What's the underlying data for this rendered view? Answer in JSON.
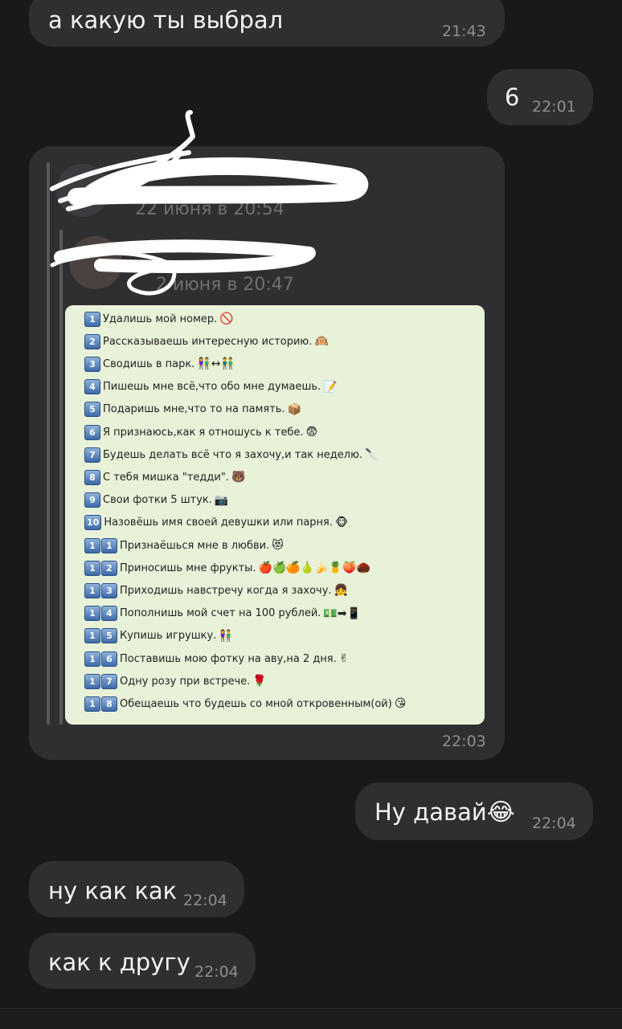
{
  "messages": {
    "m1": {
      "text": "а какую ты выбрал",
      "time": "21:43"
    },
    "m2": {
      "text": "6",
      "time": "22:01"
    },
    "m3": {
      "forward_date_outer": "22 июня в 20:54",
      "forward_date_inner": "2 июня в 20:47",
      "time": "22:03"
    },
    "m4": {
      "text": "Ну давай",
      "emoji": "😂",
      "time": "22:04"
    },
    "m5": {
      "text": "ну как как",
      "time": "22:04"
    },
    "m6": {
      "text": "как к другу",
      "time": "22:04"
    }
  },
  "photo_list": [
    {
      "num": [
        "1"
      ],
      "text": "Удалишь мой номер.",
      "emoji": "🚫"
    },
    {
      "num": [
        "2"
      ],
      "text": "Рассказываешь интересную историю.",
      "emoji": "🙉"
    },
    {
      "num": [
        "3"
      ],
      "text": "Сводишь в парк.",
      "emoji": "👫↔👬"
    },
    {
      "num": [
        "4"
      ],
      "text": "Пишешь мне всё,что обо мне думаешь.",
      "emoji": "📝"
    },
    {
      "num": [
        "5"
      ],
      "text": "Подаришь мне,что то на память.",
      "emoji": "📦"
    },
    {
      "num": [
        "6"
      ],
      "text": "Я признаюсь,как я отношусь к тебе.",
      "emoji": "😨"
    },
    {
      "num": [
        "7"
      ],
      "text": "Будешь делать всё что я захочу,и так неделю.",
      "emoji": "🔪"
    },
    {
      "num": [
        "8"
      ],
      "text": "С тебя мишка \"тедди\".",
      "emoji": "🐻"
    },
    {
      "num": [
        "9"
      ],
      "text": "Свои фотки 5 штук.",
      "emoji": "📷"
    },
    {
      "num": [
        "10"
      ],
      "text": "Назовёшь имя своей девушки или парня.",
      "emoji": "🐵"
    },
    {
      "num": [
        "1",
        "1"
      ],
      "text": "Признаёшься мне в любви.",
      "emoji": "😻"
    },
    {
      "num": [
        "1",
        "2"
      ],
      "text": "Приносишь мне фрукты.",
      "emoji": "🍎🍏🍊🍐🍌🍍🍑🌰"
    },
    {
      "num": [
        "1",
        "3"
      ],
      "text": "Приходишь навстречу когда я захочу.",
      "emoji": "👧"
    },
    {
      "num": [
        "1",
        "4"
      ],
      "text": "Пополнишь мой счет на 100 рублей.",
      "emoji": "💵➡📱"
    },
    {
      "num": [
        "1",
        "5"
      ],
      "text": "Купишь игрушку.",
      "emoji": "👫"
    },
    {
      "num": [
        "1",
        "6"
      ],
      "text": "Поставишь мою фотку на аву,на 2 дня.",
      "emoji": "✌"
    },
    {
      "num": [
        "1",
        "7"
      ],
      "text": "Одну розу при встрече.",
      "emoji": "🌹"
    },
    {
      "num": [
        "1",
        "8"
      ],
      "text": "Обещаешь что будешь со мной откровенным(ой)",
      "emoji": "😘"
    }
  ],
  "colors": {
    "background": "#19191b",
    "bubble": "#2f2f31",
    "time": "#8e8e93",
    "photo_bg": "#e8f2d9"
  }
}
